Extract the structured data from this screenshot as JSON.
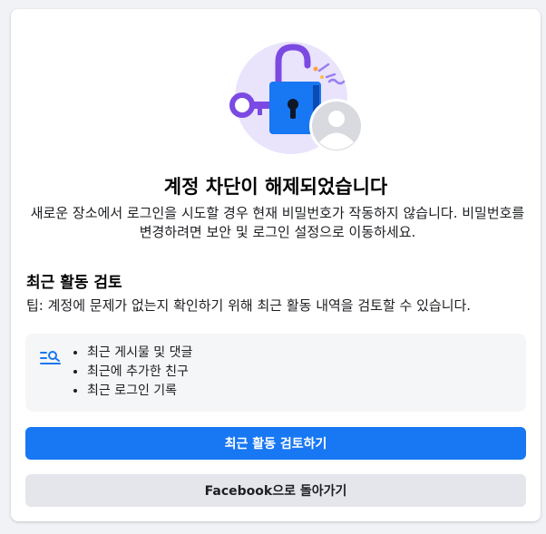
{
  "header": {
    "title": "계정 차단이 해제되었습니다",
    "description": "새로운 장소에서 로그인을 시도할 경우 현재 비밀번호가 작동하지 않습니다. 비밀번호를 변경하려면 보안 및 로그인 설정으로 이동하세요."
  },
  "review": {
    "section_title": "최근 활동 검토",
    "tip": "팁: 계정에 문제가 없는지 확인하기 위해 최근 활동 내역을 검토할 수 있습니다.",
    "items": [
      {
        "label": "최근 게시물 및 댓글"
      },
      {
        "label": "최근에 추가한 친구"
      },
      {
        "label": "최근 로그인 기록"
      }
    ]
  },
  "buttons": {
    "primary_label": "최근 활동 검토하기",
    "secondary_label": "Facebook으로 돌아가기"
  },
  "icons": {
    "illustration": "unlocked-padlock-icon",
    "avatar": "avatar-icon",
    "list": "list-search-icon"
  },
  "colors": {
    "accent": "#1877f2",
    "lock_shackle": "#7b4ae2",
    "secondary_button": "#e4e6eb",
    "box_bg": "#f5f6f7"
  }
}
